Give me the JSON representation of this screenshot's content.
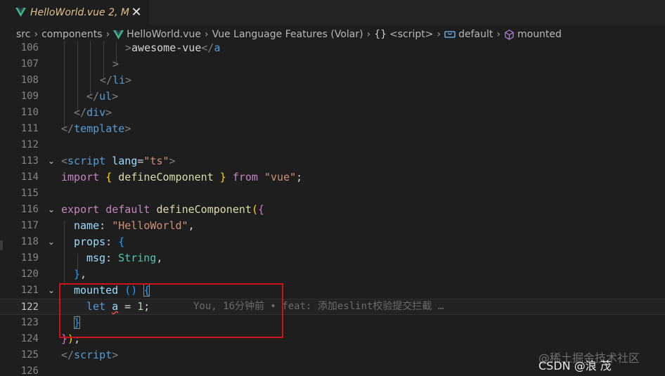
{
  "tab": {
    "title": "HelloWorld.vue",
    "status": "2, M",
    "close": "✕"
  },
  "breadcrumb": {
    "items": [
      "src",
      "components",
      "HelloWorld.vue",
      "Vue Language Features (Volar)",
      "<script>",
      "default",
      "mounted"
    ]
  },
  "editor": {
    "line_numbers": [
      "106",
      "107",
      "108",
      "109",
      "110",
      "111",
      "112",
      "113",
      "114",
      "115",
      "116",
      "117",
      "118",
      "119",
      "120",
      "121",
      "122",
      "123",
      "124",
      "125",
      "126"
    ],
    "current_line": "122",
    "blame": "You, 16分钟前 • feat: 添加eslint校验提交拦截 …"
  },
  "watermark": {
    "site": "@稀土掘金技术社区",
    "author": "CSDN @浪  茂"
  },
  "colors": {
    "background": "#1e1e1e",
    "tab_modified": "#e2c08d",
    "vue_green": "#41b883",
    "annotation_box": "#d0121b"
  }
}
